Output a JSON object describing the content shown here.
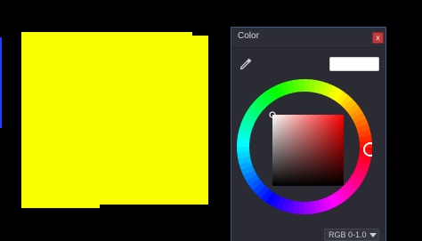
{
  "color_panel": {
    "title": "Color",
    "close_label": "x",
    "current_color": "#ffffff",
    "mode_label": "RGB 0-1.0",
    "icons": {
      "eyedropper": "eyedropper-icon",
      "close": "close-icon",
      "mode_dropdown": "chevron-down-icon"
    }
  },
  "canvas": {
    "fill_color": "#f8ff00",
    "accent_color": "#1f3cff"
  }
}
